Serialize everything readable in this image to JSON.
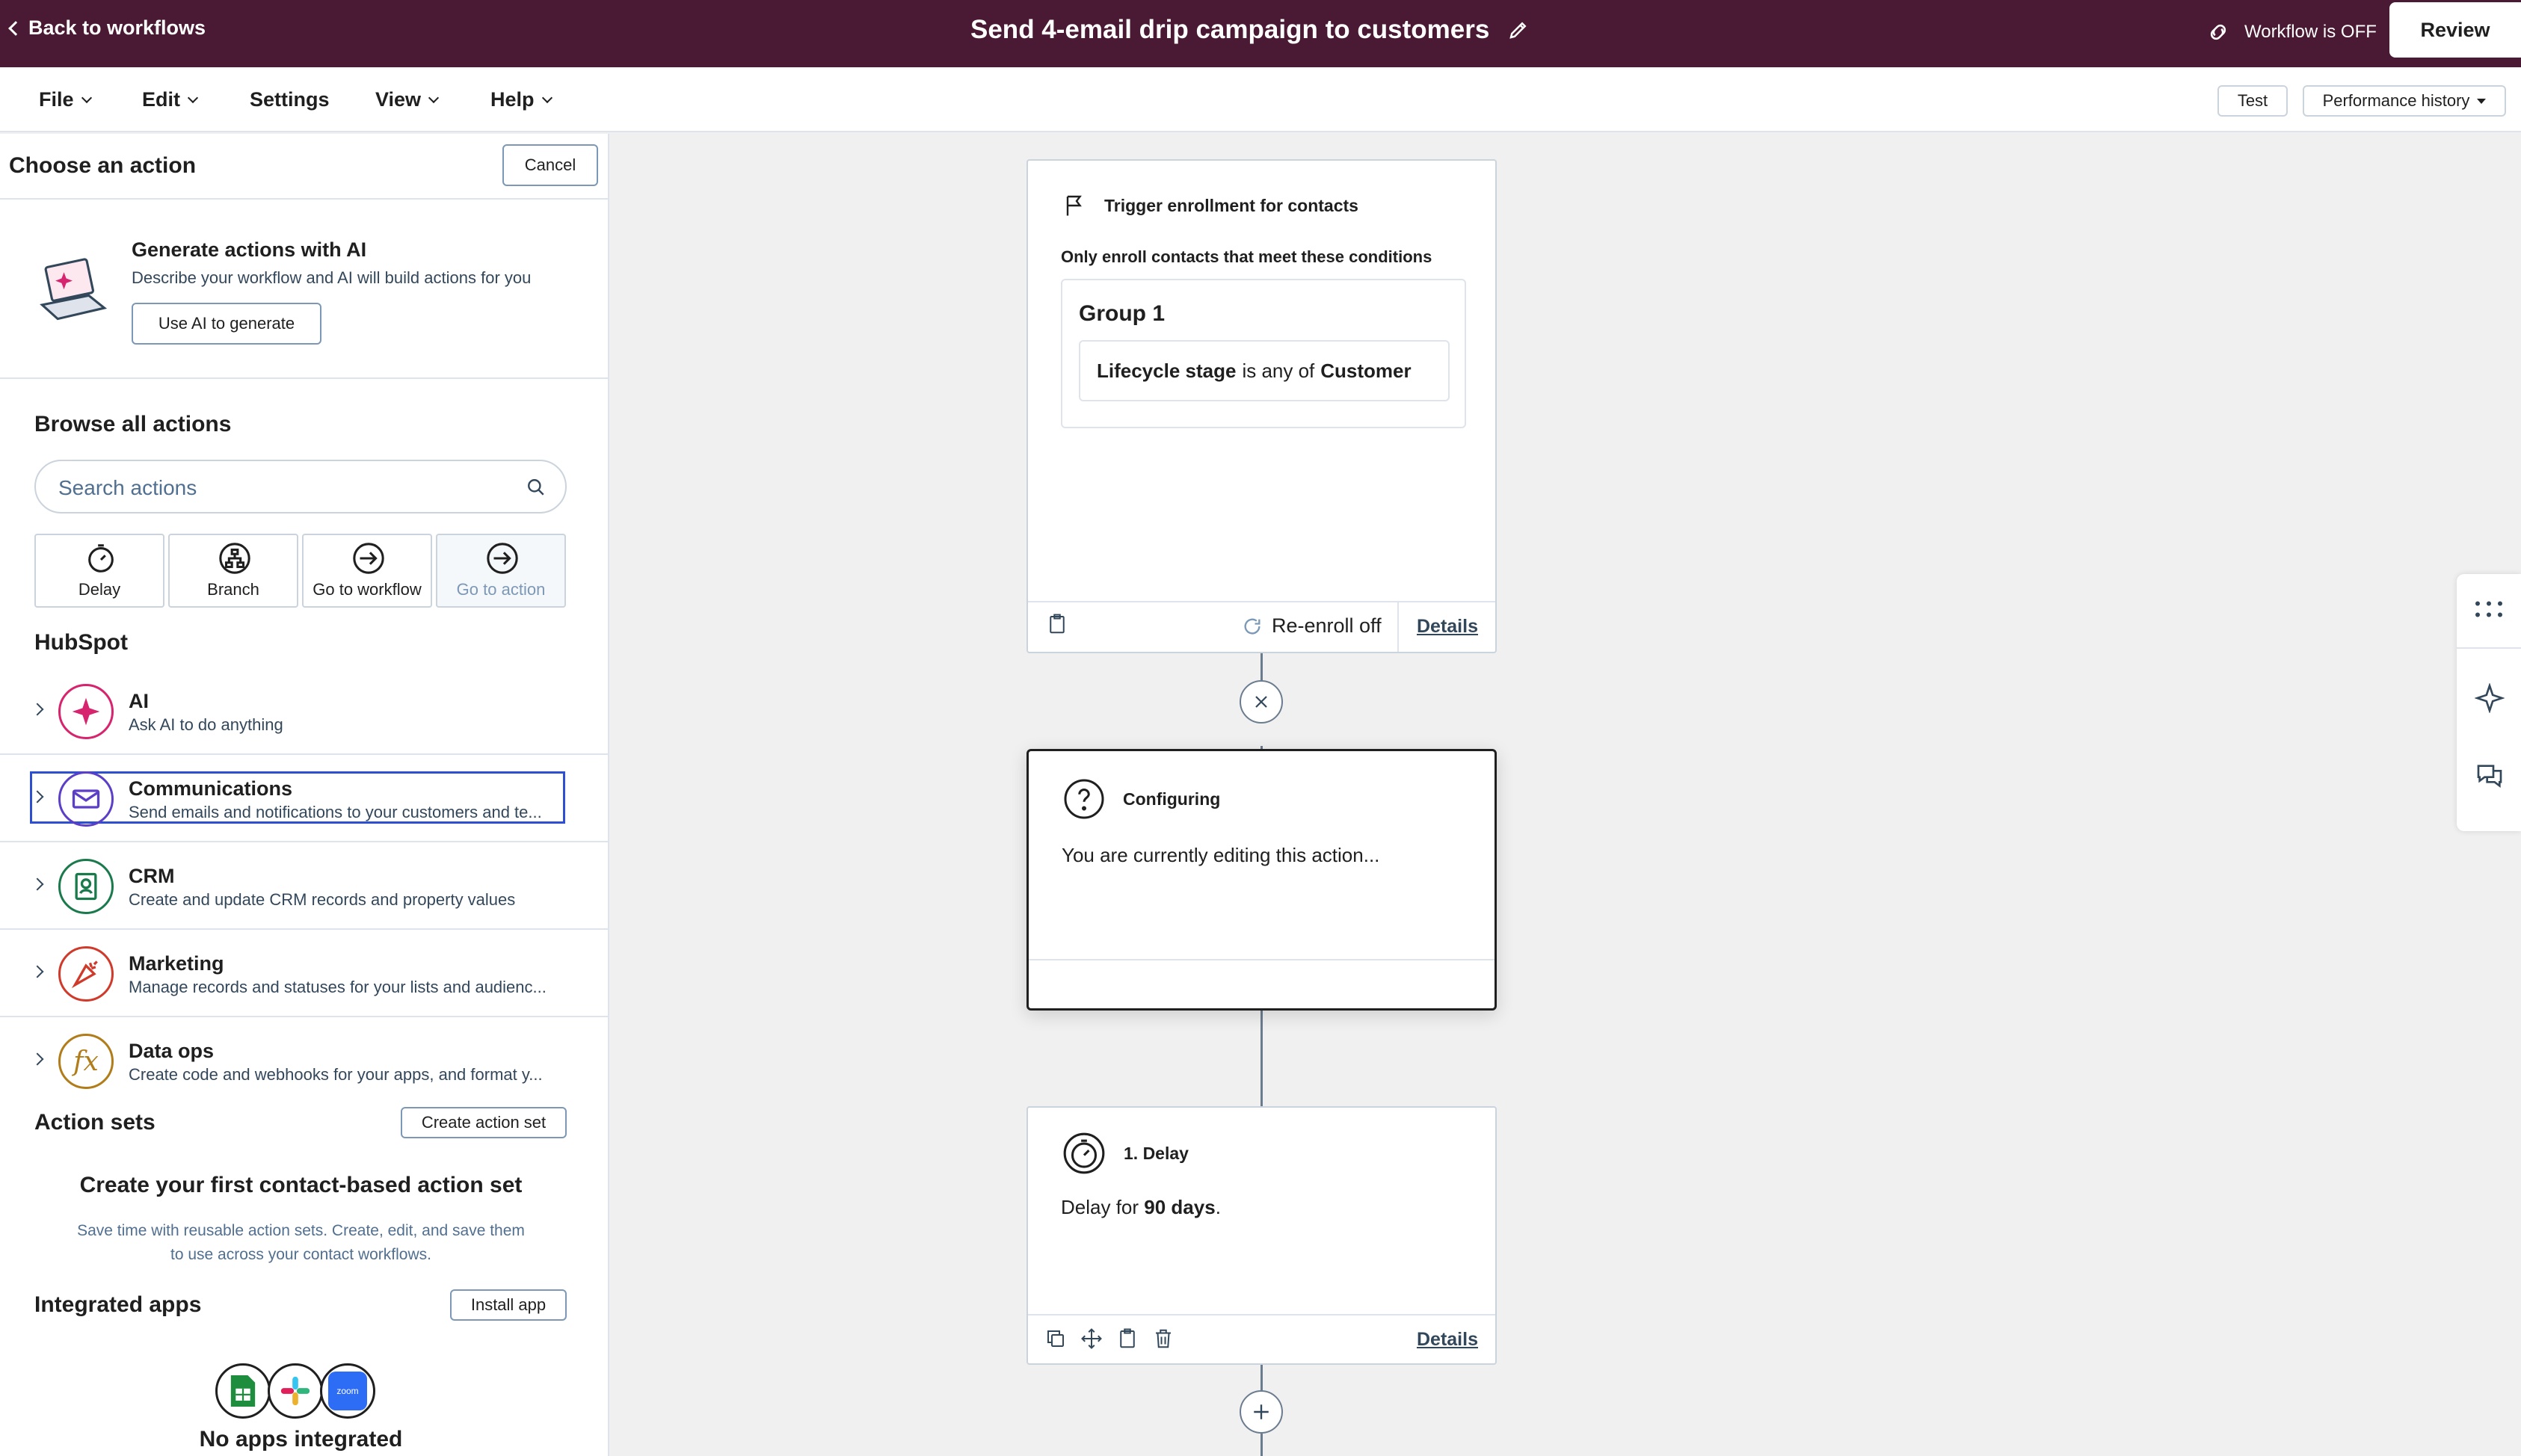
{
  "topbar": {
    "back_label": "Back to workflows",
    "title": "Send 4-email drip campaign to customers",
    "status": "Workflow is OFF",
    "review_label": "Review"
  },
  "menu": {
    "items": [
      "File",
      "Edit",
      "Settings",
      "View",
      "Help"
    ],
    "test_label": "Test",
    "performance_label": "Performance history"
  },
  "panel": {
    "title": "Choose an action",
    "cancel_label": "Cancel",
    "ai": {
      "title": "Generate actions with AI",
      "desc": "Describe your workflow and AI will build actions for you",
      "button": "Use AI to generate"
    },
    "browse_title": "Browse all actions",
    "search_placeholder": "Search actions",
    "tiles": [
      "Delay",
      "Branch",
      "Go to workflow",
      "Go to action"
    ],
    "hubspot_title": "HubSpot",
    "categories": [
      {
        "name": "AI",
        "desc": "Ask AI to do anything",
        "color": "#d6246e"
      },
      {
        "name": "Communications",
        "desc": "Send emails and notifications to your customers and te...",
        "color": "#5c3fc7"
      },
      {
        "name": "CRM",
        "desc": "Create and update CRM records and property values",
        "color": "#1a7a4c"
      },
      {
        "name": "Marketing",
        "desc": "Manage records and statuses for your lists and audienc...",
        "color": "#d03a2b"
      },
      {
        "name": "Data ops",
        "desc": "Create code and webhooks for your apps, and format y...",
        "color": "#b07d1a"
      }
    ],
    "action_sets": {
      "title": "Action sets",
      "button": "Create action set",
      "heading": "Create your first contact-based action set",
      "desc_line1": "Save time with reusable action sets. Create, edit, and save them",
      "desc_line2": "to use across your contact workflows."
    },
    "integrated": {
      "title": "Integrated apps",
      "button": "Install app",
      "zoom_label": "zoom",
      "empty": "No apps integrated"
    }
  },
  "canvas": {
    "trigger": {
      "title": "Trigger enrollment for contacts",
      "subtitle": "Only enroll contacts that meet these conditions",
      "group": "Group 1",
      "cond_property": "Lifecycle stage",
      "cond_op": "is any of",
      "cond_value": "Customer",
      "reenroll": "Re-enroll off",
      "details": "Details"
    },
    "configuring": {
      "title": "Configuring",
      "text": "You are currently editing this action..."
    },
    "delay": {
      "title": "1. Delay",
      "text_prefix": "Delay for",
      "text_value": "90 days",
      "text_suffix": ".",
      "details": "Details"
    }
  },
  "colors": {
    "topbar_bg": "#4a1933",
    "selection": "#2d4fd0"
  }
}
